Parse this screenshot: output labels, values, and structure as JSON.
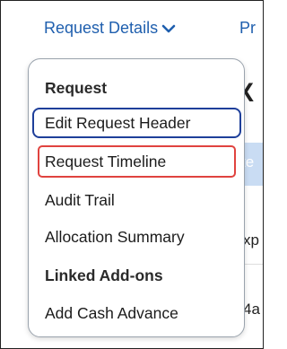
{
  "topbar": {
    "request_details_label": "Request Details",
    "next_label_partial": "Pr"
  },
  "background": {
    "big_glyph": "X",
    "band_text": "te",
    "row1_text": "xp",
    "row2_text": "4a"
  },
  "menu": {
    "items": [
      {
        "label": "Request",
        "type": "heading"
      },
      {
        "label": "Edit Request Header",
        "type": "item",
        "highlight": "blue"
      },
      {
        "label": "Request Timeline",
        "type": "item",
        "highlight": "red"
      },
      {
        "label": "Audit Trail",
        "type": "item"
      },
      {
        "label": "Allocation Summary",
        "type": "item"
      },
      {
        "label": "Linked Add-ons",
        "type": "heading"
      },
      {
        "label": "Add Cash Advance",
        "type": "item"
      }
    ]
  },
  "colors": {
    "link_blue": "#1f5fae",
    "focus_blue": "#1e3f9a",
    "highlight_red": "#e0433f"
  },
  "icons": {
    "dropdown": "chevron-down-icon"
  }
}
